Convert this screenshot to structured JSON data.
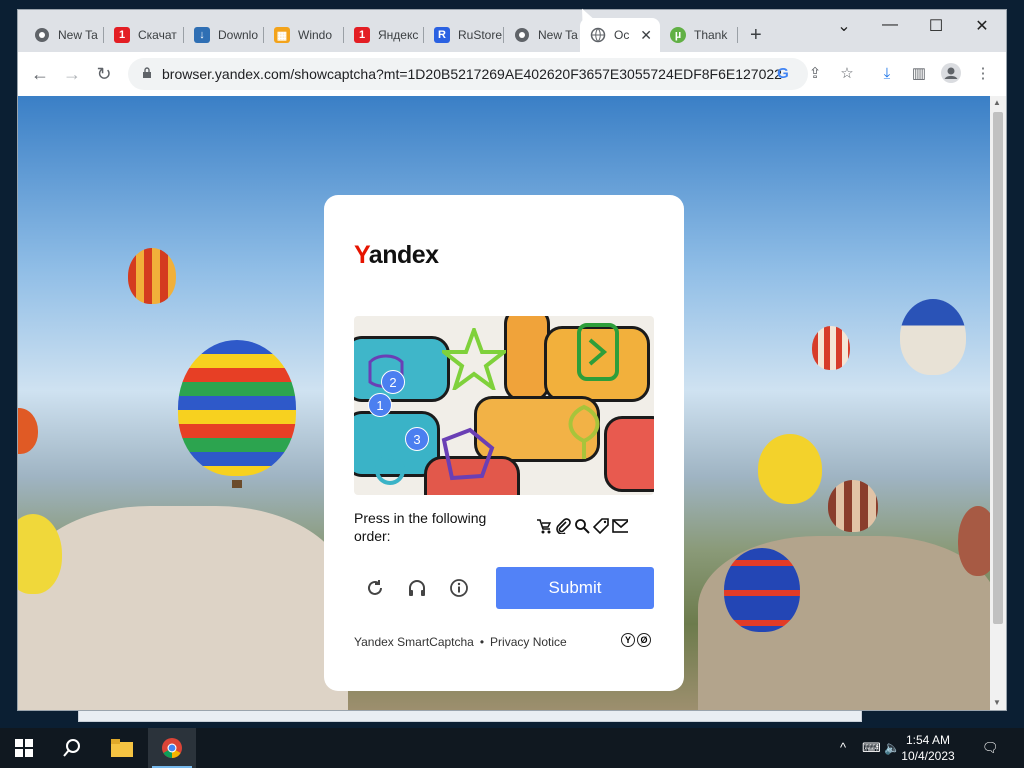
{
  "desktop_peek": {
    "items_text": "",
    "selected_text": ""
  },
  "browser": {
    "tabs": [
      {
        "label": "New Ta",
        "icon": "chrome-icon",
        "active": false
      },
      {
        "label": "Скачат",
        "icon": "red-number-icon",
        "active": false
      },
      {
        "label": "Downlo",
        "icon": "download-site-icon",
        "active": false
      },
      {
        "label": "Windo",
        "icon": "windows-site-icon",
        "active": false
      },
      {
        "label": "Яндекс",
        "icon": "red-number-icon",
        "active": false
      },
      {
        "label": "RuStore",
        "icon": "rustore-icon",
        "active": false
      },
      {
        "label": "New Ta",
        "icon": "chrome-icon",
        "active": false
      },
      {
        "label": "Oc",
        "icon": "globe-icon",
        "active": true
      },
      {
        "label": "Thank",
        "icon": "utorrent-icon",
        "active": false
      }
    ],
    "url": "browser.yandex.com/showcaptcha?mt=1D20B5217269AE402620F3657E3055724EDF8F6E127022..."
  },
  "captcha": {
    "logo_first": "Y",
    "logo_rest": "andex",
    "prompt": "Press in the following order:",
    "markers": [
      "1",
      "2",
      "3"
    ],
    "order_icons": [
      "trolley-icon",
      "paperclip-icon",
      "magnifier-icon",
      "tag-icon",
      "envelope-icon"
    ],
    "submit_label": "Submit",
    "footer_brand": "Yandex SmartCaptcha",
    "footer_dot": "•",
    "footer_privacy": "Privacy Notice",
    "footer_logo_letters": [
      "Y",
      "Ø"
    ]
  },
  "taskbar": {
    "time": "1:54 AM",
    "date": "10/4/2023"
  }
}
